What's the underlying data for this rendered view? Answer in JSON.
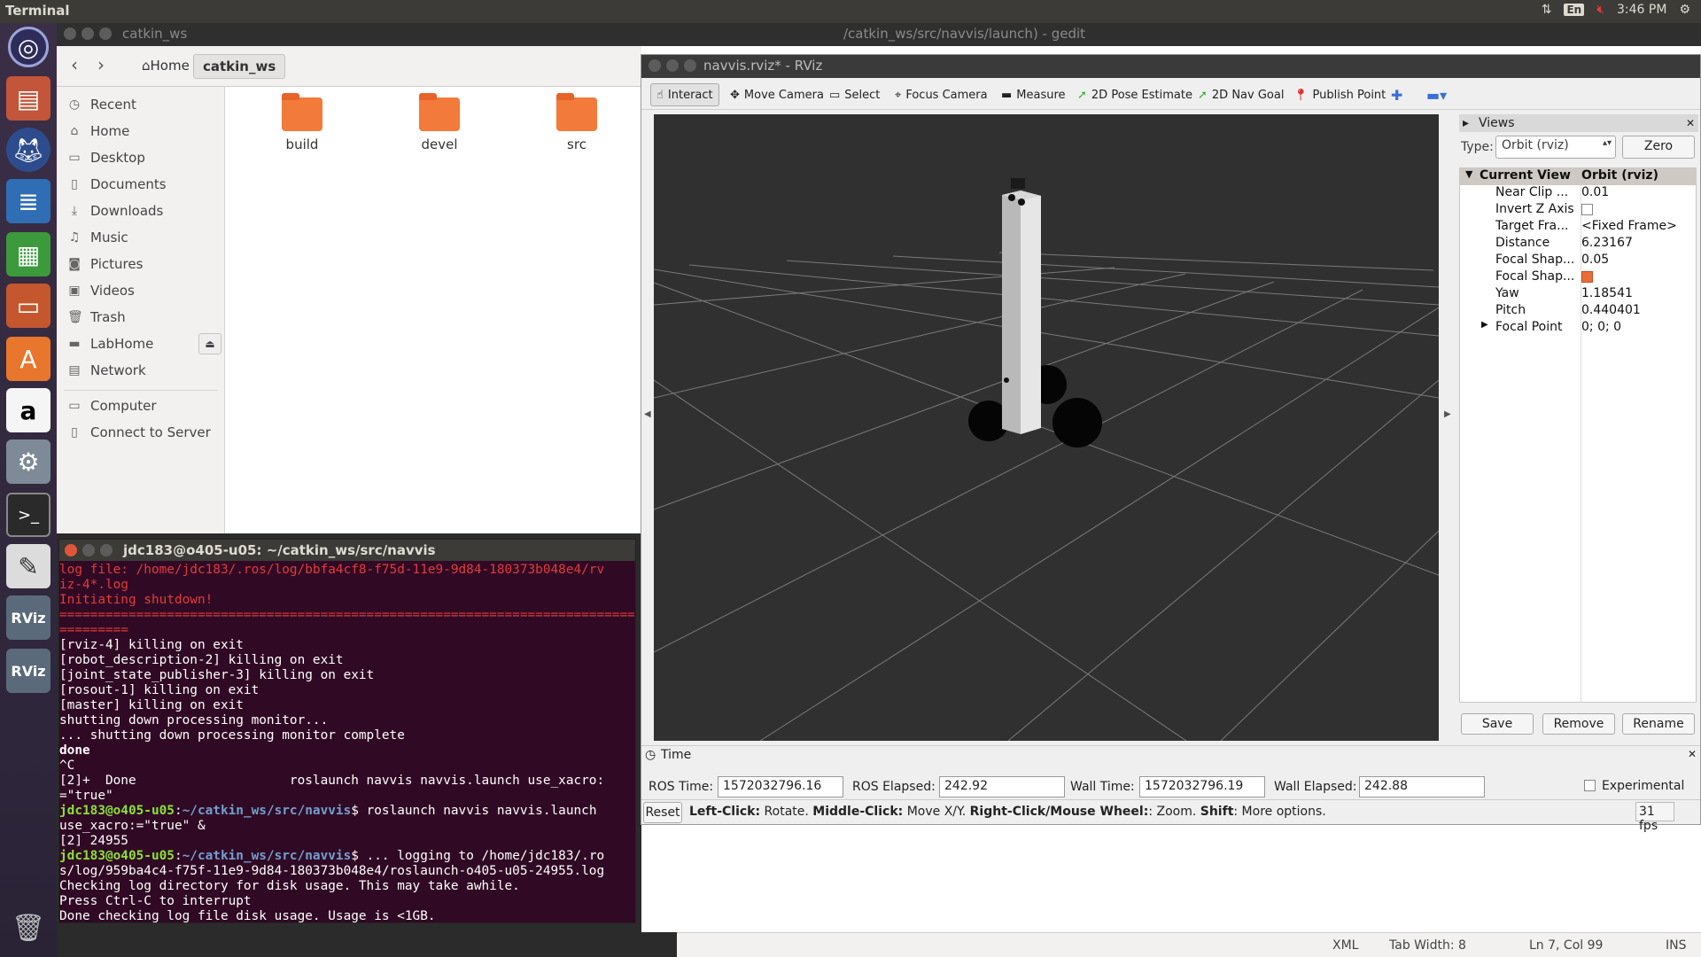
{
  "topbar": {
    "app_title": "Terminal",
    "kbd_layout": "En",
    "clock": "3:46 PM"
  },
  "launcher": {
    "icons": [
      "ubuntu-dash-icon",
      "files-icon",
      "firefox-icon",
      "writer-icon",
      "calc-icon",
      "impress-icon",
      "software-center-icon",
      "amazon-icon",
      "system-settings-icon",
      "terminal-icon",
      "gedit-icon",
      "rviz-icon",
      "rviz-icon",
      "trash-icon"
    ]
  },
  "file_manager": {
    "title": "catkin_ws",
    "breadcrumbs": [
      "Home",
      "catkin_ws"
    ],
    "sidebar": [
      {
        "label": "Recent",
        "icon": "clock-icon"
      },
      {
        "label": "Home",
        "icon": "home-icon"
      },
      {
        "label": "Desktop",
        "icon": "desktop-icon"
      },
      {
        "label": "Documents",
        "icon": "document-icon"
      },
      {
        "label": "Downloads",
        "icon": "download-icon"
      },
      {
        "label": "Music",
        "icon": "music-icon"
      },
      {
        "label": "Pictures",
        "icon": "camera-icon"
      },
      {
        "label": "Videos",
        "icon": "video-icon"
      },
      {
        "label": "Trash",
        "icon": "trash-icon"
      },
      {
        "label": "LabHome",
        "icon": "drive-icon"
      },
      {
        "label": "Network",
        "icon": "network-icon"
      },
      {
        "label": "Computer",
        "icon": "computer-icon"
      },
      {
        "label": "Connect to Server",
        "icon": "server-icon"
      }
    ],
    "folders": [
      "build",
      "devel",
      "src"
    ]
  },
  "gedit": {
    "title": "/catkin_ws/src/navvis/launch) - gedit",
    "status": {
      "lang": "XML",
      "tab_width": "Tab Width: 8",
      "position": "Ln 7, Col 99",
      "mode": "INS"
    }
  },
  "rviz": {
    "title": "navvis.rviz* - RViz",
    "tools": [
      "Interact",
      "Move Camera",
      "Select",
      "Focus Camera",
      "Measure",
      "2D Pose Estimate",
      "2D Nav Goal",
      "Publish Point"
    ],
    "views": {
      "panel_title": "Views",
      "type_label": "Type:",
      "type_value": "Orbit (rviz)",
      "zero_button": "Zero",
      "tree_header": {
        "key": "Current View",
        "value": "Orbit (rviz)"
      },
      "properties": [
        {
          "key": "Near Clip ...",
          "value": "0.01"
        },
        {
          "key": "Invert Z Axis",
          "value": ""
        },
        {
          "key": "Target Fra...",
          "value": "<Fixed Frame>"
        },
        {
          "key": "Distance",
          "value": "6.23167"
        },
        {
          "key": "Focal Shap...",
          "value": "0.05"
        },
        {
          "key": "Focal Shap...",
          "value": ""
        },
        {
          "key": "Yaw",
          "value": "1.18541"
        },
        {
          "key": "Pitch",
          "value": "0.440401"
        },
        {
          "key": "Focal Point",
          "value": "0; 0; 0"
        }
      ],
      "buttons": [
        "Save",
        "Remove",
        "Rename"
      ]
    },
    "time": {
      "panel_title": "Time",
      "ros_time_label": "ROS Time:",
      "ros_time": "1572032796.16",
      "ros_elapsed_label": "ROS Elapsed:",
      "ros_elapsed": "242.92",
      "wall_time_label": "Wall Time:",
      "wall_time": "1572032796.19",
      "wall_elapsed_label": "Wall Elapsed:",
      "wall_elapsed": "242.88",
      "experimental": "Experimental"
    },
    "status": {
      "reset": "Reset",
      "hint_lc": "Left-Click:",
      "hint_lc_t": " Rotate. ",
      "hint_mc": "Middle-Click:",
      "hint_mc_t": " Move X/Y. ",
      "hint_rc": "Right-Click/Mouse Wheel:",
      "hint_rc_t": ": Zoom. ",
      "hint_sh": "Shift",
      "hint_sh_t": ": More options.",
      "fps": "31 fps"
    }
  },
  "terminal": {
    "title": "jdc183@o405-u05: ~/catkin_ws/src/navvis",
    "lines": [
      {
        "cls": "red",
        "text": "log file: /home/jdc183/.ros/log/bbfa4cf8-f75d-11e9-9d84-180373b048e4/rv"
      },
      {
        "cls": "red",
        "text": "iz-4*.log"
      },
      {
        "cls": "red",
        "text": "Initiating shutdown!"
      },
      {
        "cls": "red",
        "text": "================================================================================"
      },
      {
        "cls": "red",
        "text": "========="
      },
      {
        "cls": "",
        "text": "[rviz-4] killing on exit"
      },
      {
        "cls": "",
        "text": "[robot_description-2] killing on exit"
      },
      {
        "cls": "",
        "text": "[joint_state_publisher-3] killing on exit"
      },
      {
        "cls": "",
        "text": "[rosout-1] killing on exit"
      },
      {
        "cls": "",
        "text": "[master] killing on exit"
      },
      {
        "cls": "",
        "text": "shutting down processing monitor..."
      },
      {
        "cls": "",
        "text": "... shutting down processing monitor complete"
      },
      {
        "cls": "bold",
        "text": "done"
      },
      {
        "cls": "",
        "text": "^C"
      },
      {
        "cls": "",
        "text": "[2]+  Done                    roslaunch navvis navvis.launch use_xacro:"
      },
      {
        "cls": "",
        "text": "=\"true\""
      },
      {
        "cls": "prompt",
        "user": "jdc183@o405-u05",
        "path": "~/catkin_ws/src/navvis",
        "text": "$ roslaunch navvis navvis.launch"
      },
      {
        "cls": "",
        "text": "use_xacro:=\"true\" &"
      },
      {
        "cls": "",
        "text": "[2] 24955"
      },
      {
        "cls": "prompt",
        "user": "jdc183@o405-u05",
        "path": "~/catkin_ws/src/navvis",
        "text": "$ ... logging to /home/jdc183/.ro"
      },
      {
        "cls": "",
        "text": "s/log/959ba4c4-f75f-11e9-9d84-180373b048e4/roslaunch-o405-u05-24955.log"
      },
      {
        "cls": "",
        "text": "Checking log directory for disk usage. This may take awhile."
      },
      {
        "cls": "",
        "text": "Press Ctrl-C to interrupt"
      },
      {
        "cls": "",
        "text": "Done checking log file disk usage. Usage is <1GB."
      }
    ]
  },
  "colors": {
    "ubuntu_orange": "#e95420",
    "terminal_bg": "#300a24",
    "rviz_bg": "#303030"
  }
}
